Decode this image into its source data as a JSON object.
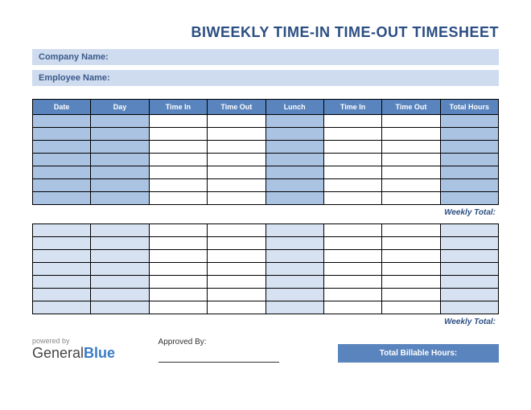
{
  "title": "BIWEEKLY TIME-IN TIME-OUT TIMESHEET",
  "info": {
    "company_label": "Company Name:",
    "employee_label": "Employee Name:"
  },
  "columns": [
    "Date",
    "Day",
    "Time In",
    "Time Out",
    "Lunch",
    "Time In",
    "Time Out",
    "Total Hours"
  ],
  "weekly_total_label": "Weekly Total:",
  "footer": {
    "powered_by": "powered by",
    "logo_general": "General",
    "logo_blue": "Blue",
    "approved_label": "Approved By:",
    "billable_label": "Total Billable Hours:"
  },
  "rows_per_week": 7,
  "shaded_columns": [
    0,
    1,
    4,
    7
  ]
}
